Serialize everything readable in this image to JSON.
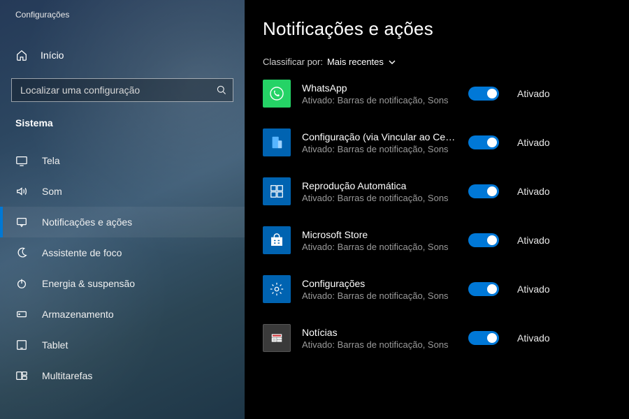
{
  "window": {
    "title": "Configurações"
  },
  "sidebar": {
    "home": "Início",
    "search_placeholder": "Localizar uma configuração",
    "section": "Sistema",
    "items": [
      {
        "label": "Tela",
        "icon": "display-icon"
      },
      {
        "label": "Som",
        "icon": "sound-icon"
      },
      {
        "label": "Notificações e ações",
        "icon": "notification-icon",
        "active": true
      },
      {
        "label": "Assistente de foco",
        "icon": "focus-icon"
      },
      {
        "label": "Energia & suspensão",
        "icon": "power-icon"
      },
      {
        "label": "Armazenamento",
        "icon": "storage-icon"
      },
      {
        "label": "Tablet",
        "icon": "tablet-icon"
      },
      {
        "label": "Multitarefas",
        "icon": "multitask-icon"
      }
    ]
  },
  "main": {
    "title": "Notificações e ações",
    "sort_label": "Classificar por:",
    "sort_value": "Mais recentes",
    "toggle_state_on": "Ativado",
    "apps": [
      {
        "name": "WhatsApp",
        "sub": "Ativado: Barras de notificação, Sons",
        "icon": "whatsapp-app-icon",
        "cls": "ico-whatsapp",
        "on": true
      },
      {
        "name": "Configuração (via Vincular ao Cel…",
        "sub": "Ativado: Barras de notificação, Sons",
        "icon": "phone-link-app-icon",
        "cls": "ico-phone",
        "on": true
      },
      {
        "name": "Reprodução Automática",
        "sub": "Ativado: Barras de notificação, Sons",
        "icon": "autoplay-app-icon",
        "cls": "ico-autoplay",
        "on": true
      },
      {
        "name": "Microsoft Store",
        "sub": "Ativado: Barras de notificação, Sons",
        "icon": "store-app-icon",
        "cls": "ico-store",
        "on": true
      },
      {
        "name": "Configurações",
        "sub": "Ativado: Barras de notificação, Sons",
        "icon": "settings-app-icon",
        "cls": "ico-settings",
        "on": true
      },
      {
        "name": "Notícias",
        "sub": "Ativado: Barras de notificação, Sons",
        "icon": "news-app-icon",
        "cls": "ico-news",
        "on": true
      }
    ]
  }
}
